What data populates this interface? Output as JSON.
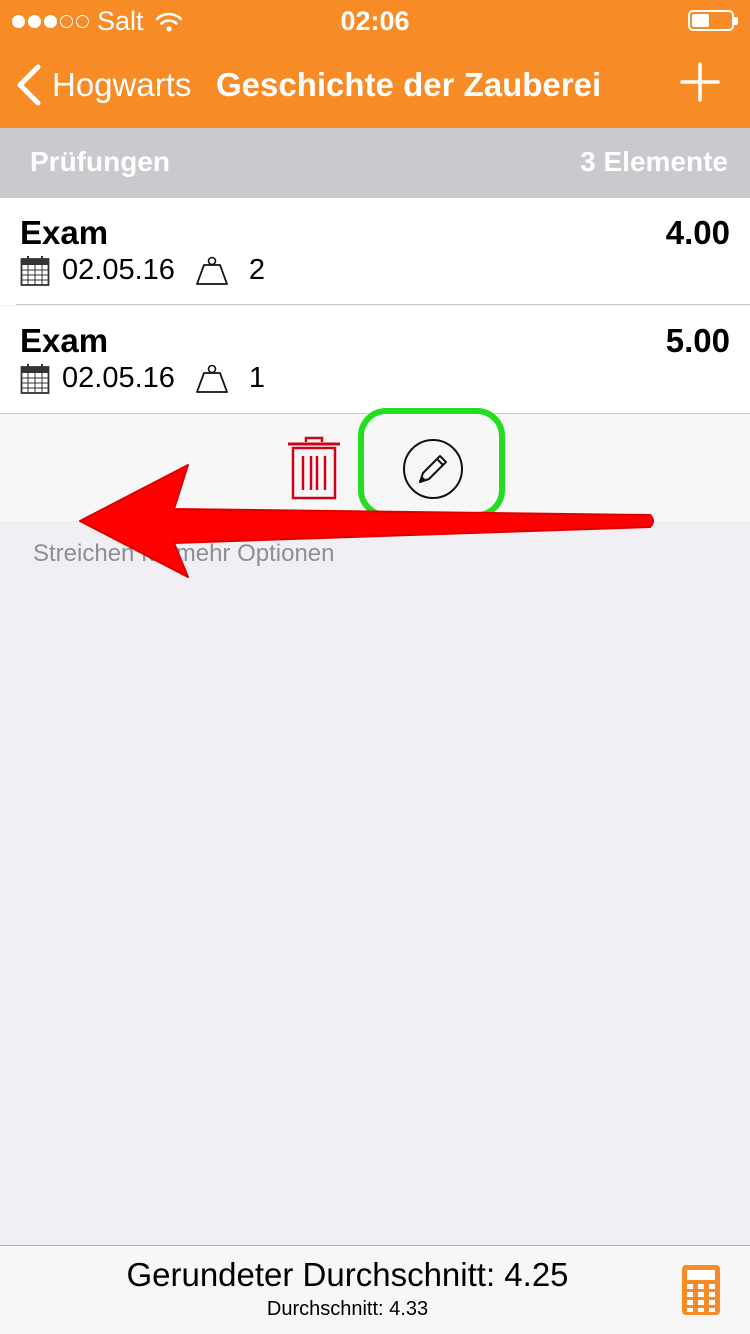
{
  "status_bar": {
    "carrier": "Salt",
    "time": "02:06",
    "battery_level": 0.45
  },
  "nav": {
    "back_label": "Hogwarts",
    "title": "Geschichte der Zauberei",
    "add_icon": "plus-icon"
  },
  "section": {
    "title": "Prüfungen",
    "count": "3 Elemente"
  },
  "exams": [
    {
      "name": "Exam",
      "grade": "4.00",
      "date": "02.05.16",
      "weight": "2"
    },
    {
      "name": "Exam",
      "grade": "5.00",
      "date": "02.05.16",
      "weight": "1"
    }
  ],
  "swipe_actions": {
    "delete_icon": "trash-icon",
    "edit_icon": "pencil-icon"
  },
  "hint": "Streichen für mehr Optionen",
  "footer": {
    "rounded_average": "Gerundeter Durchschnitt: 4.25",
    "average": "Durchschnitt: 4.33",
    "calculator_icon": "calculator-icon"
  },
  "colors": {
    "accent": "#f78b26",
    "delete": "#d0021b",
    "highlight": "#22dd22",
    "arrow": "#ff0000"
  }
}
